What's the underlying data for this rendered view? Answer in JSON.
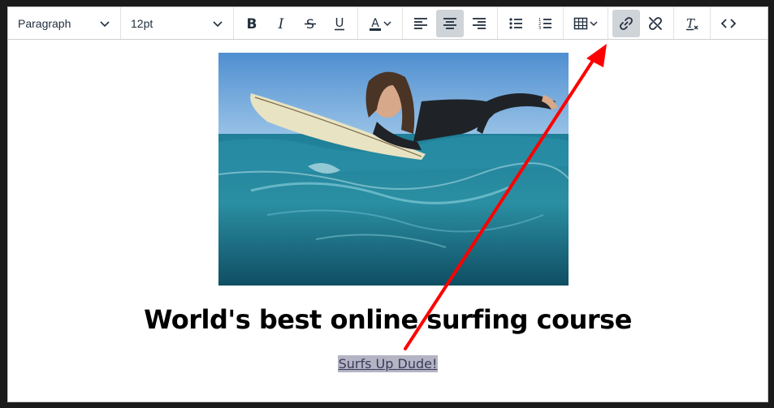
{
  "toolbar": {
    "block_format": "Paragraph",
    "font_size": "12pt",
    "icons": [
      "bold-icon",
      "italic-icon",
      "strikethrough-icon",
      "underline-icon",
      "text-color-icon",
      "align-left-icon",
      "align-center-icon",
      "align-right-icon",
      "bullet-list-icon",
      "numbered-list-icon",
      "table-icon",
      "link-icon",
      "unlink-icon",
      "clear-format-icon",
      "source-code-icon"
    ],
    "text_color_swatch": "#222f3e",
    "active_color": "#cfd4d9"
  },
  "document": {
    "heading": "World's best online surfing course",
    "link_text": "Surfs Up Dude!"
  },
  "annotation": {
    "arrow_color": "#ff0000"
  }
}
